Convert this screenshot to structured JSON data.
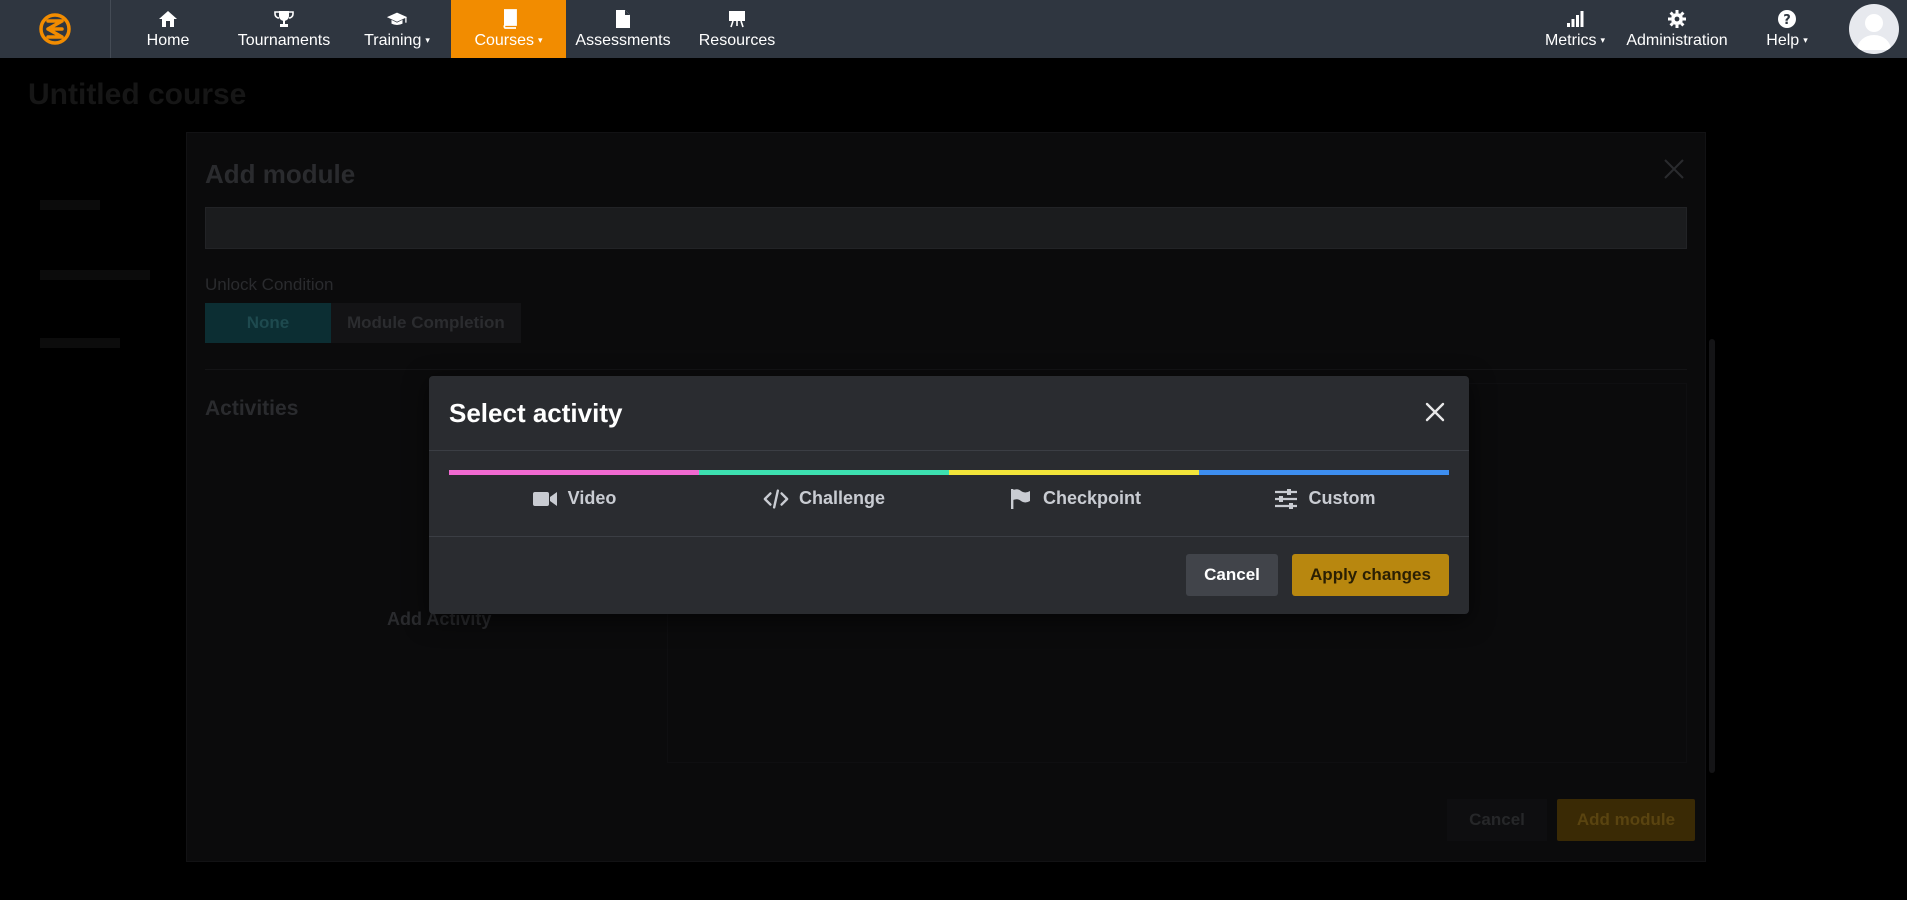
{
  "nav": {
    "items": [
      {
        "key": "home",
        "label": "Home",
        "icon": "home-icon",
        "dropdown": false,
        "active": false
      },
      {
        "key": "tournaments",
        "label": "Tournaments",
        "icon": "trophy-icon",
        "dropdown": false,
        "active": false
      },
      {
        "key": "training",
        "label": "Training",
        "icon": "graduation-cap-icon",
        "dropdown": true,
        "active": false
      },
      {
        "key": "courses",
        "label": "Courses",
        "icon": "book-icon",
        "dropdown": true,
        "active": true
      },
      {
        "key": "assessments",
        "label": "Assessments",
        "icon": "document-icon",
        "dropdown": false,
        "active": false
      },
      {
        "key": "resources",
        "label": "Resources",
        "icon": "easel-icon",
        "dropdown": false,
        "active": false
      }
    ],
    "right_items": [
      {
        "key": "metrics",
        "label": "Metrics",
        "icon": "bar-chart-icon",
        "dropdown": true
      },
      {
        "key": "administration",
        "label": "Administration",
        "icon": "gear-icon",
        "dropdown": false
      },
      {
        "key": "help",
        "label": "Help",
        "icon": "question-icon",
        "dropdown": true
      }
    ],
    "caret": "▾",
    "accent_color": "#f28c00",
    "bar_color": "#2f3640"
  },
  "background": {
    "page_title": "Untitled course",
    "module_dialog": {
      "title": "Add module",
      "unlock_label": "Unlock Condition",
      "unlock_options": [
        "None",
        "Module Completion"
      ],
      "activities_heading": "Activities",
      "add_activity": "Add Activity",
      "cancel": "Cancel",
      "add_module": "Add module"
    }
  },
  "dialog": {
    "title": "Select activity",
    "tabs": [
      {
        "label": "Video",
        "icon": "video-camera-icon",
        "color": "#f06ad0"
      },
      {
        "label": "Challenge",
        "icon": "code-icon",
        "color": "#3de0b0"
      },
      {
        "label": "Checkpoint",
        "icon": "flag-icon",
        "color": "#f2e53a"
      },
      {
        "label": "Custom",
        "icon": "sliders-icon",
        "color": "#3d8ef0"
      }
    ],
    "cancel_label": "Cancel",
    "apply_label": "Apply changes"
  }
}
